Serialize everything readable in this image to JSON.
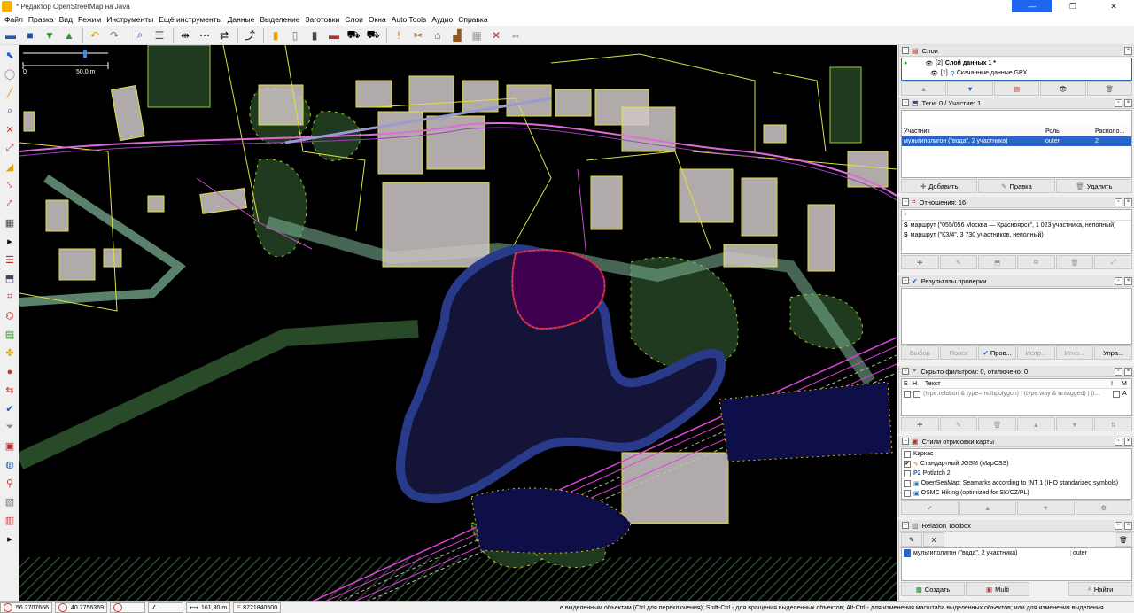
{
  "window": {
    "title": "* Редактор OpenStreetMap на Java",
    "minimize": "—",
    "maximize": "❐",
    "close": "✕"
  },
  "menu": [
    "Файл",
    "Правка",
    "Вид",
    "Режим",
    "Инструменты",
    "Ещё инструменты",
    "Данные",
    "Выделение",
    "Заготовки",
    "Слои",
    "Окна",
    "Auto Tools",
    "Аудио",
    "Справка"
  ],
  "toolbar_icons": [
    "open-file-icon",
    "save-icon",
    "download-icon",
    "upload-icon",
    "undo-icon",
    "redo-icon",
    "zoom-icon",
    "align-icon",
    "distribute-icon",
    "reverse-icon",
    "split-icon",
    "building-icon",
    "house-icon",
    "door-icon",
    "barrier-icon",
    "car-icon",
    "car2-icon",
    "warning-icon",
    "tools-icon",
    "gate-icon",
    "chart-icon",
    "map-icon",
    "tool2-icon",
    "expand-icon"
  ],
  "left_tools": [
    "select-icon",
    "lasso-icon",
    "draw-icon",
    "zoom-icon",
    "nodes-icon",
    "ways-icon",
    "area-icon",
    "split-icon",
    "merge-icon",
    "building-icon",
    "more-icon",
    "layers-icon",
    "tag-icon",
    "relation-icon",
    "map-icon",
    "cross-icon",
    "paint-icon",
    "arrows-icon",
    "validator-icon",
    "filter-icon",
    "styles-icon",
    "globe-icon",
    "pin-icon",
    "toolbox-icon",
    "grid-icon",
    "more-icon"
  ],
  "map": {
    "scale_zero": "0",
    "scale_label": "50,0 m"
  },
  "layers": {
    "title": "Слои",
    "items": [
      {
        "num": "[2]",
        "name": "Слой данных 1 *"
      },
      {
        "num": "[1]",
        "name": "Скачанные данные GPX"
      }
    ]
  },
  "tags": {
    "title": "Теги: 0 / Участие: 1",
    "columns": [
      "Участник",
      "Роль",
      "Располо..."
    ],
    "rows": [
      {
        "member": "мультиполигон (\"вода\", 2 участника)",
        "role": "outer",
        "pos": "2"
      }
    ],
    "buttons": {
      "add": "Добавить",
      "edit": "Правка",
      "delete": "Удалить"
    }
  },
  "relations": {
    "title": "Отношения: 16",
    "items": [
      "маршрут (\"055/056 Москва — Красноярск\", 1 023 участника, неполный)",
      "маршрут (\"КЗ/4\", 3 730 участников, неполный)"
    ]
  },
  "validation": {
    "title": "Результаты проверки",
    "buttons": [
      "Выбор",
      "Поиск",
      "Пров...",
      "Испр...",
      "Игно...",
      "Упра..."
    ]
  },
  "filter": {
    "title": "Скрыто фильтром: 0, отключено: 0",
    "col_e": "E",
    "col_h": "H",
    "col_text": "Текст",
    "col_i": "I",
    "col_m": "M",
    "row_text": "(type:relation & type=multipolygon) | (type:way & untagged) | (t...",
    "row_m": "A"
  },
  "styles": {
    "title": "Стили отрисовки карты",
    "items": [
      {
        "name": "Каркас",
        "checked": false
      },
      {
        "name": "Стандартный JOSM (MapCSS)",
        "checked": true
      },
      {
        "name": "Potlatch 2",
        "checked": false
      },
      {
        "name": "OpenSeaMap: Seamarks according to INT 1 (IHO standarized symbols)",
        "checked": false
      },
      {
        "name": "OSMC Hiking (optimized for SK/CZ/PL)",
        "checked": false
      }
    ]
  },
  "toolbox": {
    "title": "Relation Toolbox",
    "x_label": "X",
    "row_name": "мультиполигон (\"вода\", 2 участника)",
    "row_role": "outer",
    "create": "Создать",
    "multi": "Multi",
    "find": "Найти"
  },
  "status": {
    "lat": "56.2707666",
    "lon": "40.7756369",
    "distance": "161,30 m",
    "id": "8721840500",
    "help": "е выделенным объектам (Ctrl для переключения); Shift-Ctrl - для вращения выделенных объектов; Alt-Ctrl - для изменения масштаба выделенных объектов; или для изменения выделения"
  },
  "colors": {
    "accent": "#2a64c8",
    "map_bg": "#000000",
    "building": "#d0c8c8",
    "outline": "#e0e040",
    "water_selected": "#400050",
    "water": "#141438",
    "wood": "#1f3a1f"
  }
}
